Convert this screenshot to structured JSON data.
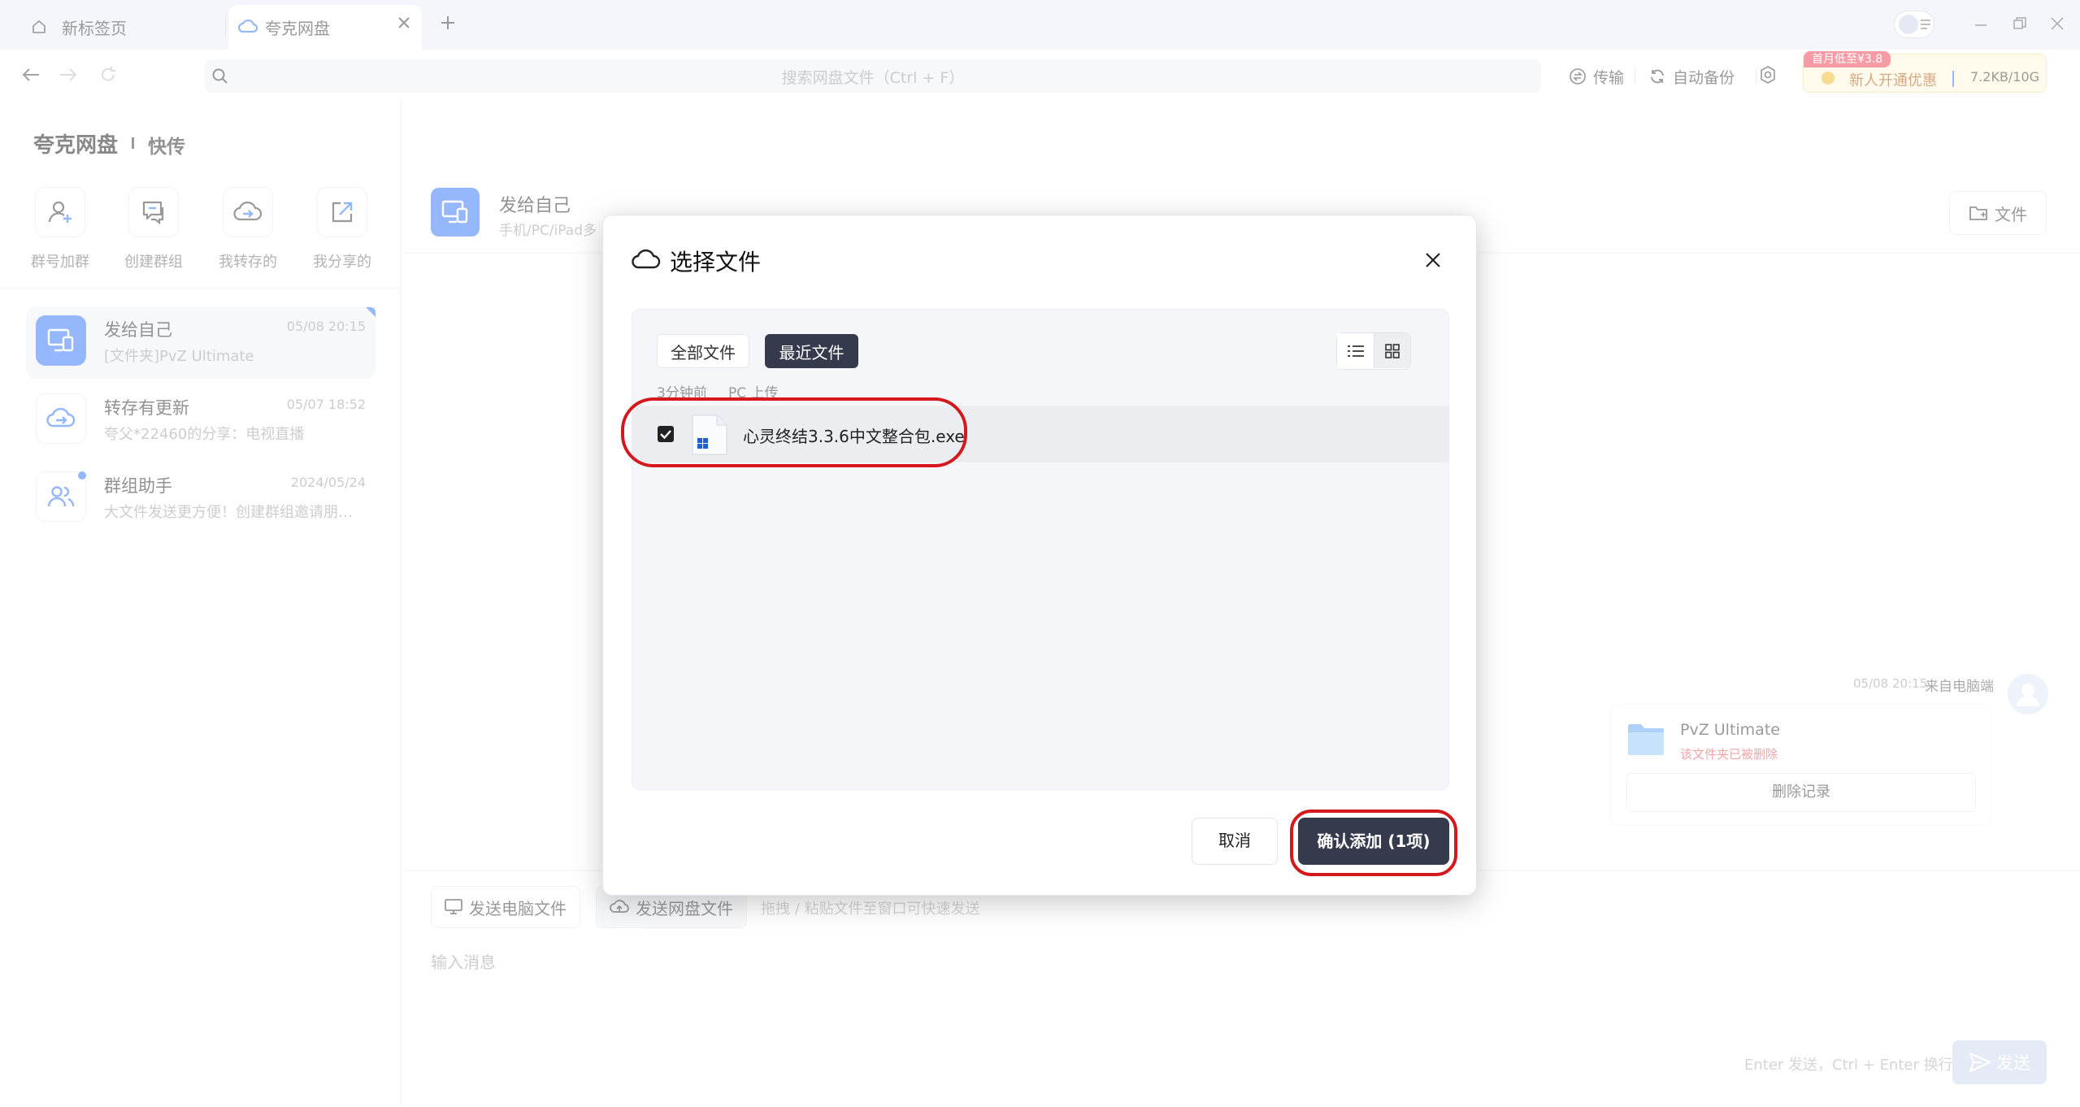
{
  "browser": {
    "tabs": [
      {
        "label": "新标签页",
        "icon": "home-icon"
      },
      {
        "label": "夸克网盘",
        "icon": "cloud-icon"
      }
    ]
  },
  "nav": {
    "search_placeholder": "搜索网盘文件（Ctrl + F）",
    "transfer_label": "传输",
    "auto_backup_label": "自动备份",
    "promo_badge": "首月低至¥3.8",
    "promo_text": "新人开通优惠",
    "storage": "7.2KB/10G"
  },
  "sidebar": {
    "brand": "夸克网盘",
    "section": "快传",
    "quick_actions": [
      {
        "label": "群号加群",
        "icon": "user-add-icon"
      },
      {
        "label": "创建群组",
        "icon": "chat-group-icon"
      },
      {
        "label": "我转存的",
        "icon": "cloud-transfer-icon"
      },
      {
        "label": "我分享的",
        "icon": "share-icon"
      }
    ],
    "conversations": [
      {
        "name": "发给自己",
        "time": "05/08 20:15",
        "snippet": "[文件夹]PvZ Ultimate"
      },
      {
        "name": "转存有更新",
        "time": "05/07 18:52",
        "snippet": "夸父*22460的分享：电视直播"
      },
      {
        "name": "群组助手",
        "time": "2024/05/24",
        "snippet": "大文件发送更方便！创建群组邀请朋友…"
      }
    ]
  },
  "main": {
    "title": "发给自己",
    "subtitle": "手机/PC/iPad多",
    "files_button": "文件",
    "message": {
      "time": "05/08 20:15",
      "source": "来自电脑端",
      "folder_name": "PvZ Ultimate",
      "folder_status": "该文件夹已被删除",
      "delete_button": "删除记录"
    },
    "send_pc_button": "发送电脑文件",
    "send_cloud_button": "发送网盘文件",
    "drop_hint": "拖拽 / 粘贴文件至窗口可快速发送",
    "input_placeholder": "输入消息",
    "send_hint": "Enter 发送，Ctrl + Enter 换行",
    "send_button": "发送"
  },
  "dialog": {
    "title": "选择文件",
    "tab_all": "全部文件",
    "tab_recent": "最近文件",
    "group_time": "3分钟前",
    "group_source": "PC 上传",
    "file_name": "心灵终结3.3.6中文整合包.exe",
    "file_checked": true,
    "cancel_button": "取消",
    "confirm_button": "确认添加 (1项)"
  },
  "colors": {
    "accent": "#2b6ef6",
    "dark_button": "#363a4d",
    "annotation_red": "#d4191e",
    "danger_text": "#e5484d"
  }
}
